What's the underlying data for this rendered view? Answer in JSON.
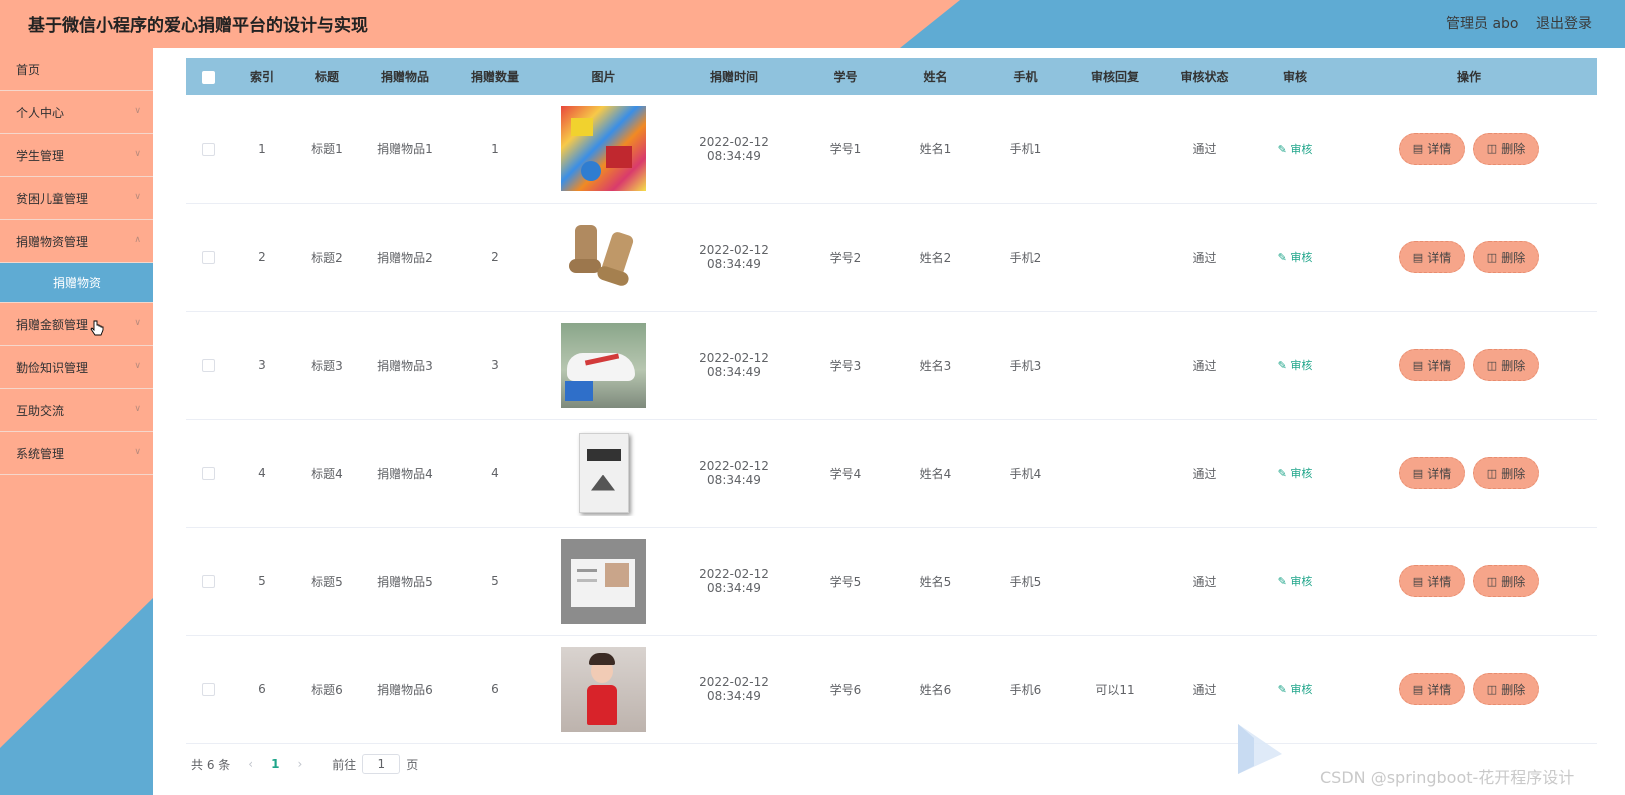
{
  "header": {
    "title": "基于微信小程序的爱心捐赠平台的设计与实现",
    "admin_label": "管理员 abo",
    "logout_label": "退出登录"
  },
  "sidebar": {
    "items": [
      {
        "label": "首页"
      },
      {
        "label": "个人中心"
      },
      {
        "label": "学生管理"
      },
      {
        "label": "贫困儿童管理"
      },
      {
        "label": "捐赠物资管理"
      },
      {
        "label": "捐赠物资"
      },
      {
        "label": "捐赠金额管理"
      },
      {
        "label": "勤俭知识管理"
      },
      {
        "label": "互助交流"
      },
      {
        "label": "系统管理"
      }
    ]
  },
  "table": {
    "columns": [
      "索引",
      "标题",
      "捐赠物品",
      "捐赠数量",
      "图片",
      "捐赠时间",
      "学号",
      "姓名",
      "手机",
      "审核回复",
      "审核状态",
      "审核",
      "操作"
    ],
    "audit_link": "审核",
    "detail_label": "详情",
    "delete_label": "删除",
    "rows": [
      {
        "index": "1",
        "title": "标题1",
        "item": "捐赠物品1",
        "qty": "1",
        "image": "snacks-image",
        "date": "2022-02-12",
        "time": "08:34:49",
        "sno": "学号1",
        "name": "姓名1",
        "phone": "手机1",
        "reply": "",
        "status": "通过"
      },
      {
        "index": "2",
        "title": "标题2",
        "item": "捐赠物品2",
        "qty": "2",
        "image": "boots-image",
        "date": "2022-02-12",
        "time": "08:34:49",
        "sno": "学号2",
        "name": "姓名2",
        "phone": "手机2",
        "reply": "",
        "status": "通过"
      },
      {
        "index": "3",
        "title": "标题3",
        "item": "捐赠物品3",
        "qty": "3",
        "image": "sneakers-image",
        "date": "2022-02-12",
        "time": "08:34:49",
        "sno": "学号3",
        "name": "姓名3",
        "phone": "手机3",
        "reply": "",
        "status": "通过"
      },
      {
        "index": "4",
        "title": "标题4",
        "item": "捐赠物品4",
        "qty": "4",
        "image": "book-image",
        "date": "2022-02-12",
        "time": "08:34:49",
        "sno": "学号4",
        "name": "姓名4",
        "phone": "手机4",
        "reply": "",
        "status": "通过"
      },
      {
        "index": "5",
        "title": "标题5",
        "item": "捐赠物品5",
        "qty": "5",
        "image": "magazine-image",
        "date": "2022-02-12",
        "time": "08:34:49",
        "sno": "学号5",
        "name": "姓名5",
        "phone": "手机5",
        "reply": "",
        "status": "通过"
      },
      {
        "index": "6",
        "title": "标题6",
        "item": "捐赠物品6",
        "qty": "6",
        "image": "person-photo-image",
        "date": "2022-02-12",
        "time": "08:34:49",
        "sno": "学号6",
        "name": "姓名6",
        "phone": "手机6",
        "reply": "可以11",
        "status": "通过"
      }
    ]
  },
  "pagination": {
    "total": "共 6 条",
    "current_page": "1",
    "goto_prefix": "前往",
    "goto_value": "1",
    "goto_suffix": "页"
  },
  "watermark": {
    "text": "CSDN @springboot-花开程序设计"
  },
  "colors": {
    "accent_salmon": "#ffab8e",
    "accent_blue": "#5fabd3",
    "table_header": "#8fc2dd",
    "audit_green": "#1fa58a"
  }
}
